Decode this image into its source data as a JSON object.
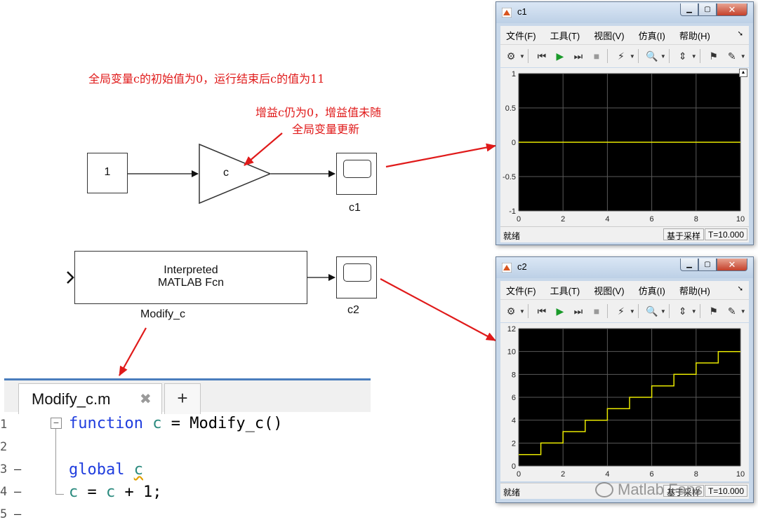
{
  "annotations": {
    "top_note": "全局变量c的初始值为0，运行结束后c的值为11",
    "gain_note_line1": "增益c仍为0，增益值未随",
    "gain_note_line2": "全局变量更新"
  },
  "model": {
    "constant_value": "1",
    "gain_label": "c",
    "scope1_label": "c1",
    "scope2_label": "c2",
    "fcn_line1": "Interpreted",
    "fcn_line2": "MATLAB Fcn",
    "fcn_label": "Modify_c"
  },
  "scope1": {
    "title": "c1",
    "menus": [
      "文件(F)",
      "工具(T)",
      "视图(V)",
      "仿真(I)",
      "帮助(H)"
    ],
    "status_left": "就绪",
    "status_mode": "基于采样",
    "status_time": "T=10.000"
  },
  "scope2": {
    "title": "c2",
    "menus": [
      "文件(F)",
      "工具(T)",
      "视图(V)",
      "仿真(I)",
      "帮助(H)"
    ],
    "status_left": "就绪",
    "status_mode": "基于采样",
    "status_time": "T=10.000"
  },
  "editor": {
    "tab_label": "Modify_c.m",
    "tab_close": "✖",
    "tab_add": "+",
    "line_numbers": [
      "1",
      "2",
      "3",
      "4",
      "5"
    ],
    "line_dashes": [
      "",
      "",
      "—",
      "—",
      "—"
    ],
    "line1_kw": "function",
    "line1_var": "c",
    "line1_rest": " = Modify_c()",
    "line3_kw": "global",
    "line3_var": "c",
    "line4_var1": "c",
    "line4_mid": " = ",
    "line4_var2": "c",
    "line4_rest": " + 1;"
  },
  "watermark": "Matlab Fans",
  "colors": {
    "annotation": "#e01a1a",
    "plot_bg": "#000000",
    "trace": "#e8e800",
    "grid": "#5a5a5a",
    "keyword": "#1f3dde",
    "variable": "#2a8a7e"
  },
  "chart_data": [
    {
      "type": "line",
      "title": "c1",
      "x": [
        0,
        10
      ],
      "y": [
        0,
        0
      ],
      "xlim": [
        0,
        10
      ],
      "ylim": [
        -1,
        1
      ],
      "xticks": [
        "0",
        "2",
        "4",
        "6",
        "8",
        "10"
      ],
      "yticks": [
        "1",
        "0.5",
        "0",
        "-0.5",
        "-1"
      ],
      "grid": true
    },
    {
      "type": "line",
      "title": "c2",
      "step": true,
      "x": [
        0,
        1,
        2,
        3,
        4,
        5,
        6,
        7,
        8,
        9,
        10
      ],
      "y": [
        1,
        2,
        3,
        4,
        5,
        6,
        7,
        8,
        9,
        10,
        10
      ],
      "xlim": [
        0,
        10
      ],
      "ylim": [
        0,
        12
      ],
      "xticks": [
        "0",
        "2",
        "4",
        "6",
        "8",
        "10"
      ],
      "yticks": [
        "12",
        "10",
        "8",
        "6",
        "4",
        "2",
        "0"
      ],
      "grid": true
    }
  ]
}
